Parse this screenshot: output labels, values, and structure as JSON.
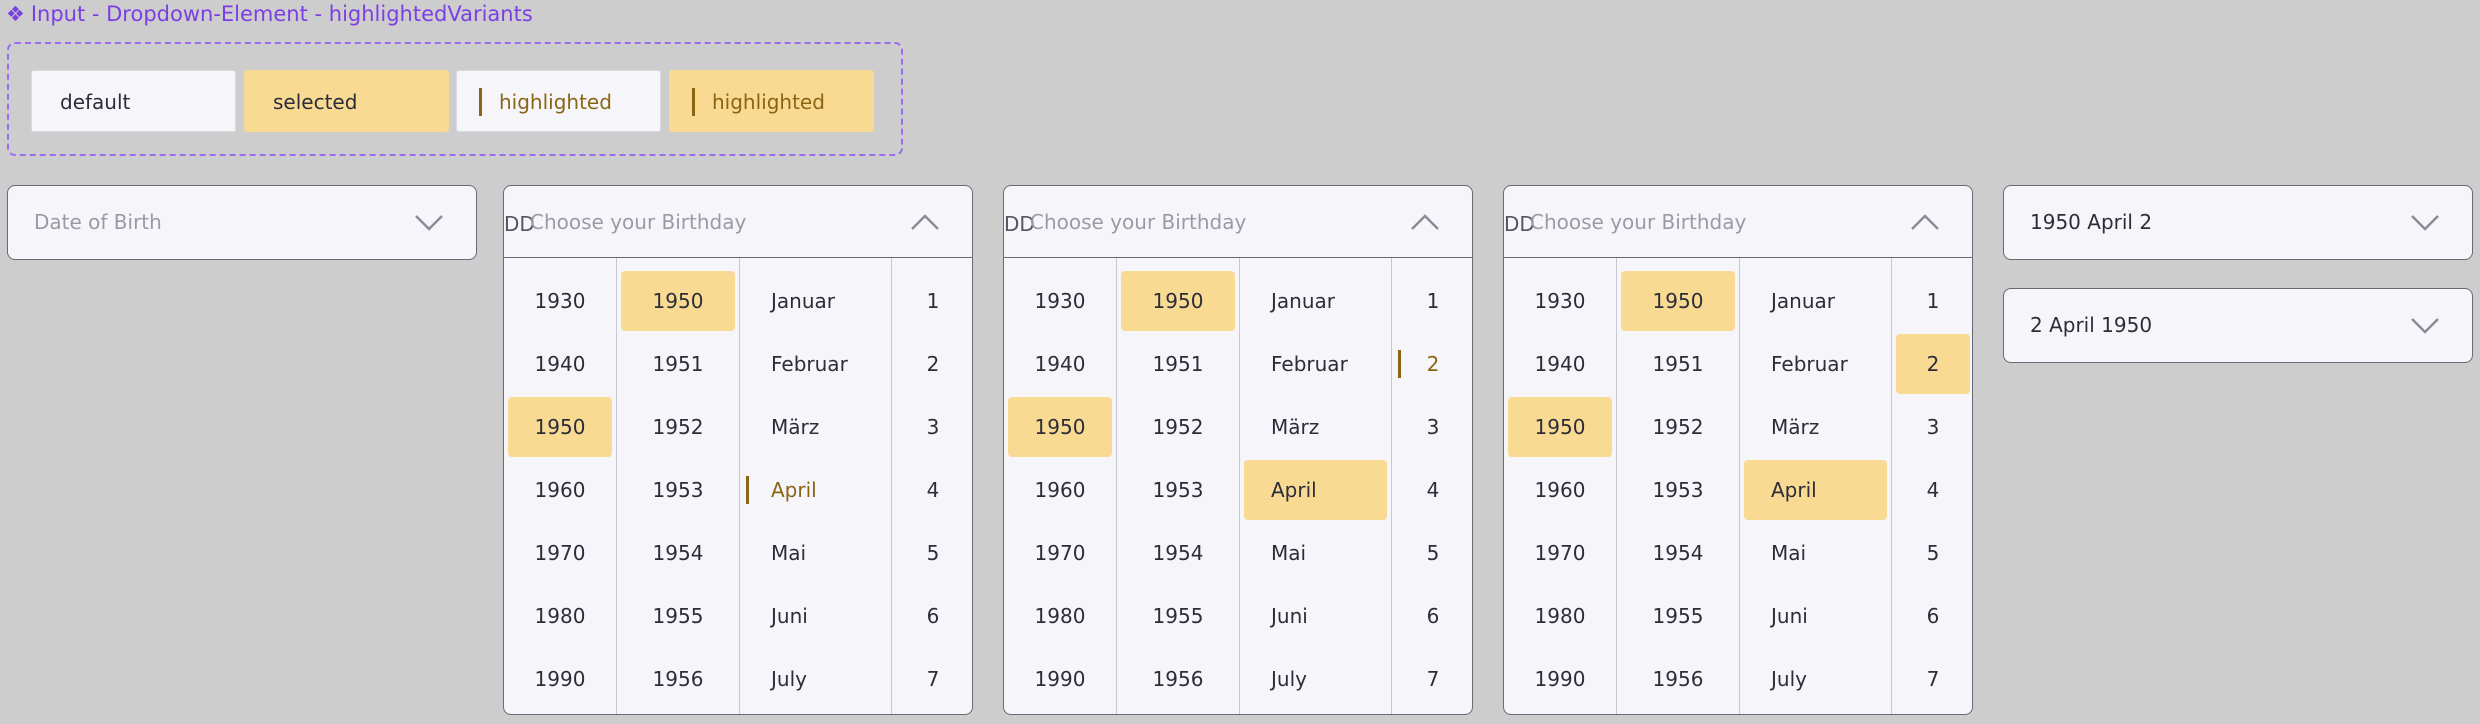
{
  "frame": {
    "glyph": "❖",
    "title": "Input - Dropdown-Element - highlightedVariants"
  },
  "variants": [
    {
      "label": "default",
      "state": "default"
    },
    {
      "label": "selected",
      "state": "selected"
    },
    {
      "label": "highlighted",
      "state": "highlighted"
    },
    {
      "label": "highlighted",
      "state": "highlighted-selected"
    }
  ],
  "closed": {
    "placeholder": "Date of Birth",
    "value_a": "1950 April 2",
    "value_b": "2 April 1950"
  },
  "open": {
    "dd_label": "DD",
    "placeholder": "Choose your Birthday",
    "decades": [
      "1930",
      "1940",
      "1950",
      "1960",
      "1970",
      "1980",
      "1990"
    ],
    "years": [
      "1950",
      "1951",
      "1952",
      "1953",
      "1954",
      "1955",
      "1956"
    ],
    "months": [
      "Januar",
      "Februar",
      "März",
      "April",
      "Mai",
      "Juni",
      "July"
    ],
    "days": [
      "1",
      "2",
      "3",
      "4",
      "5",
      "6",
      "7"
    ]
  },
  "dropdowns": [
    {
      "decade": 2,
      "year": 0,
      "month": 3,
      "month_state": "highlighted",
      "day": -1,
      "day_state": "none"
    },
    {
      "decade": 2,
      "year": 0,
      "month": 3,
      "month_state": "selected",
      "day": 1,
      "day_state": "highlighted"
    },
    {
      "decade": 2,
      "year": 0,
      "month": 3,
      "month_state": "selected",
      "day": 1,
      "day_state": "selected"
    }
  ],
  "colors": {
    "background": "#cdcdcd",
    "frame_accent": "#9b6cf0",
    "selected_fill": "#f8da92",
    "highlight_text": "#8a6513",
    "surface": "#f6f6fa"
  }
}
